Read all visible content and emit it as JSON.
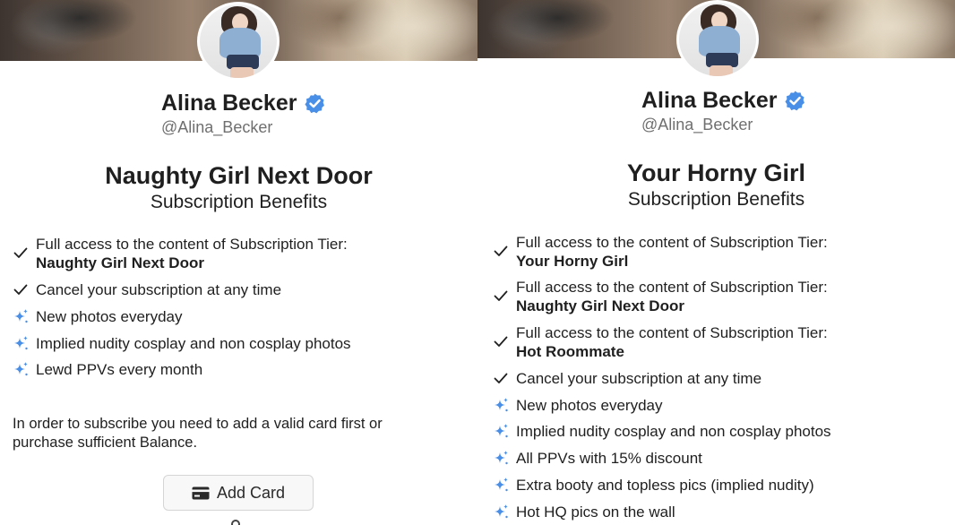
{
  "colors": {
    "accent": "#4a8fe7",
    "text": "#1f1f1f",
    "muted": "#6f6f6f"
  },
  "left": {
    "creator": {
      "name": "Alina Becker",
      "handle": "@Alina_Becker"
    },
    "tier": {
      "title": "Naughty Girl Next Door",
      "subtitle": "Subscription Benefits"
    },
    "benefits": [
      {
        "icon": "check-icon",
        "text": "Full access to the content of Subscription Tier:",
        "bold": "Naughty Girl Next Door"
      },
      {
        "icon": "check-icon",
        "text": "Cancel your subscription at any time"
      },
      {
        "icon": "sparkle-icon",
        "text": "New photos everyday"
      },
      {
        "icon": "sparkle-icon",
        "text": "Implied nudity cosplay and non cosplay photos"
      },
      {
        "icon": "sparkle-icon",
        "text": "Lewd PPVs every month"
      }
    ],
    "notice": "In order to subscribe you need to add a valid card first or purchase sufficient Balance.",
    "add_card_label": "Add Card"
  },
  "right": {
    "creator": {
      "name": "Alina Becker",
      "handle": "@Alina_Becker"
    },
    "tier": {
      "title": "Your Horny Girl",
      "subtitle": "Subscription Benefits"
    },
    "benefits": [
      {
        "icon": "check-icon",
        "text": "Full access to the content of Subscription Tier:",
        "bold": "Your Horny Girl"
      },
      {
        "icon": "check-icon",
        "text": "Full access to the content of Subscription Tier:",
        "bold": "Naughty Girl Next Door"
      },
      {
        "icon": "check-icon",
        "text": "Full access to the content of Subscription Tier:",
        "bold": "Hot Roommate"
      },
      {
        "icon": "check-icon",
        "text": "Cancel your subscription at any time"
      },
      {
        "icon": "sparkle-icon",
        "text": "New photos everyday"
      },
      {
        "icon": "sparkle-icon",
        "text": "Implied nudity cosplay and non cosplay photos"
      },
      {
        "icon": "sparkle-icon",
        "text": "All PPVs with 15% discount"
      },
      {
        "icon": "sparkle-icon",
        "text": "Extra booty and topless pics (implied nudity)"
      },
      {
        "icon": "sparkle-icon",
        "text": "Hot HQ pics on the wall"
      }
    ]
  }
}
